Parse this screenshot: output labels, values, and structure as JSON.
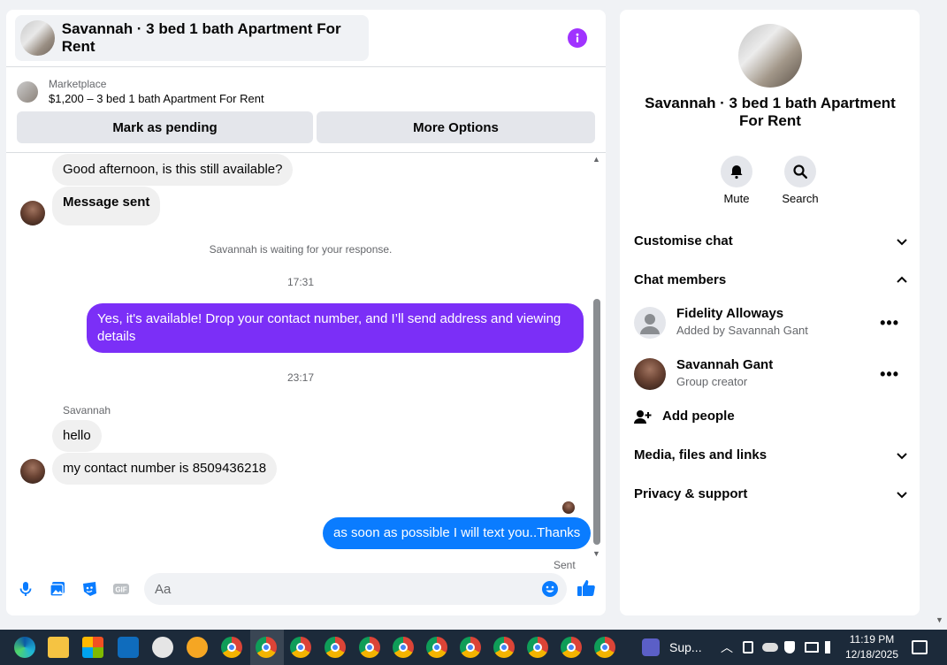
{
  "chat": {
    "title": "Savannah · 3 bed 1 bath Apartment For Rent",
    "marketplace_label": "Marketplace",
    "listing": "$1,200 – 3 bed 1 bath Apartment For Rent",
    "mark_pending_label": "Mark as pending",
    "more_options_label": "More Options",
    "messages": {
      "m1": "Good afternoon, is this still available?",
      "m2": "Message sent",
      "waiting_note": "Savannah is waiting for your response.",
      "time1": "17:31",
      "m3": "Yes, it's available! Drop your contact number, and I’ll send address and viewing details",
      "time2": "23:17",
      "sender": "Savannah",
      "m4": "hello",
      "m5": "my contact number is 8509436218",
      "m6": "as soon as possible I will text you..Thanks",
      "status": "Sent"
    },
    "input_placeholder": "Aa"
  },
  "side": {
    "title": "Savannah · 3 bed 1 bath Apartment For Rent",
    "mute_label": "Mute",
    "search_label": "Search",
    "customise_chat": "Customise chat",
    "chat_members": "Chat members",
    "members": [
      {
        "name": "Fidelity Alloways",
        "sub": "Added by Savannah Gant"
      },
      {
        "name": "Savannah Gant",
        "sub": "Group creator"
      }
    ],
    "add_people": "Add people",
    "media": "Media, files and links",
    "privacy": "Privacy & support"
  },
  "taskbar": {
    "app_label": "Sup...",
    "time": "11:19 PM",
    "date": "12/18/2025"
  },
  "colors": {
    "accent_purple": "#7b2ff7",
    "accent_blue": "#0a7cff",
    "info_icon": "#a033ff"
  }
}
